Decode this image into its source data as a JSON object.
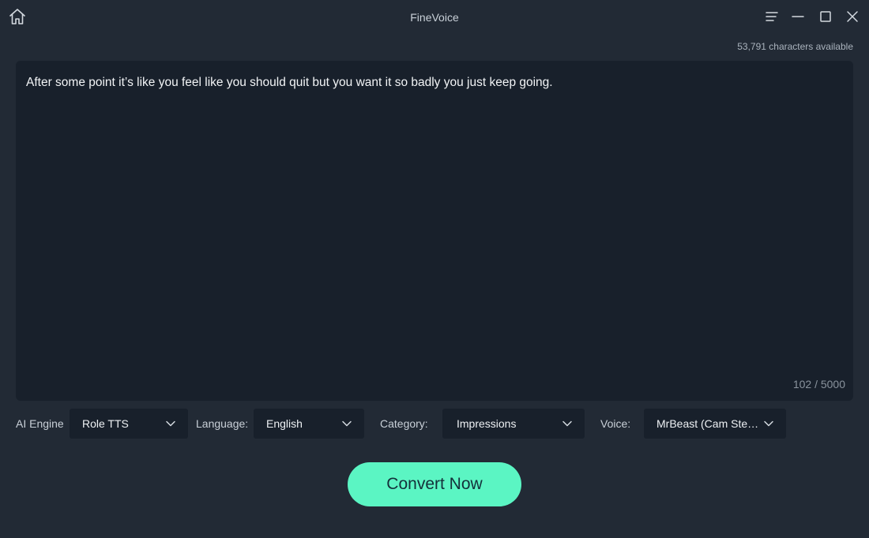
{
  "app": {
    "title": "FineVoice"
  },
  "header": {
    "chars_available": "53,791 characters available"
  },
  "editor": {
    "text": "After some point it’s like you feel like you should quit but you want it so badly you just keep going.",
    "char_count": "102 / 5000"
  },
  "controls": {
    "engine": {
      "label": "AI Engine",
      "value": "Role TTS"
    },
    "language": {
      "label": "Language:",
      "value": "English"
    },
    "category": {
      "label": "Category:",
      "value": "Impressions"
    },
    "voice": {
      "label": "Voice:",
      "value": "MrBeast (Cam Stea..."
    }
  },
  "actions": {
    "convert_label": "Convert Now"
  },
  "icons": {
    "home": "home-icon",
    "menu": "hamburger-menu-icon",
    "minimize": "minimize-icon",
    "maximize": "maximize-icon",
    "close": "close-icon",
    "chevron": "chevron-down-icon"
  },
  "colors": {
    "background": "#222a35",
    "editor_background": "#18202b",
    "accent": "#5bf5c3"
  }
}
